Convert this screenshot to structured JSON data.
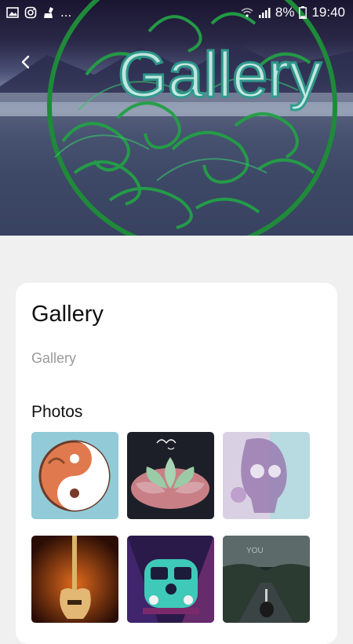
{
  "status_bar": {
    "battery": "8%",
    "time": "19:40",
    "more": "..."
  },
  "header": {
    "banner_title": "Gallery",
    "back_icon": "chevron-left-icon"
  },
  "card": {
    "title": "Gallery",
    "subtitle": "Gallery",
    "section_title": "Photos",
    "photos": [
      "yin-yang-photo",
      "succulent-photo",
      "skull-photo",
      "guitar-photo",
      "van-photo",
      "road-guitar-photo"
    ]
  }
}
